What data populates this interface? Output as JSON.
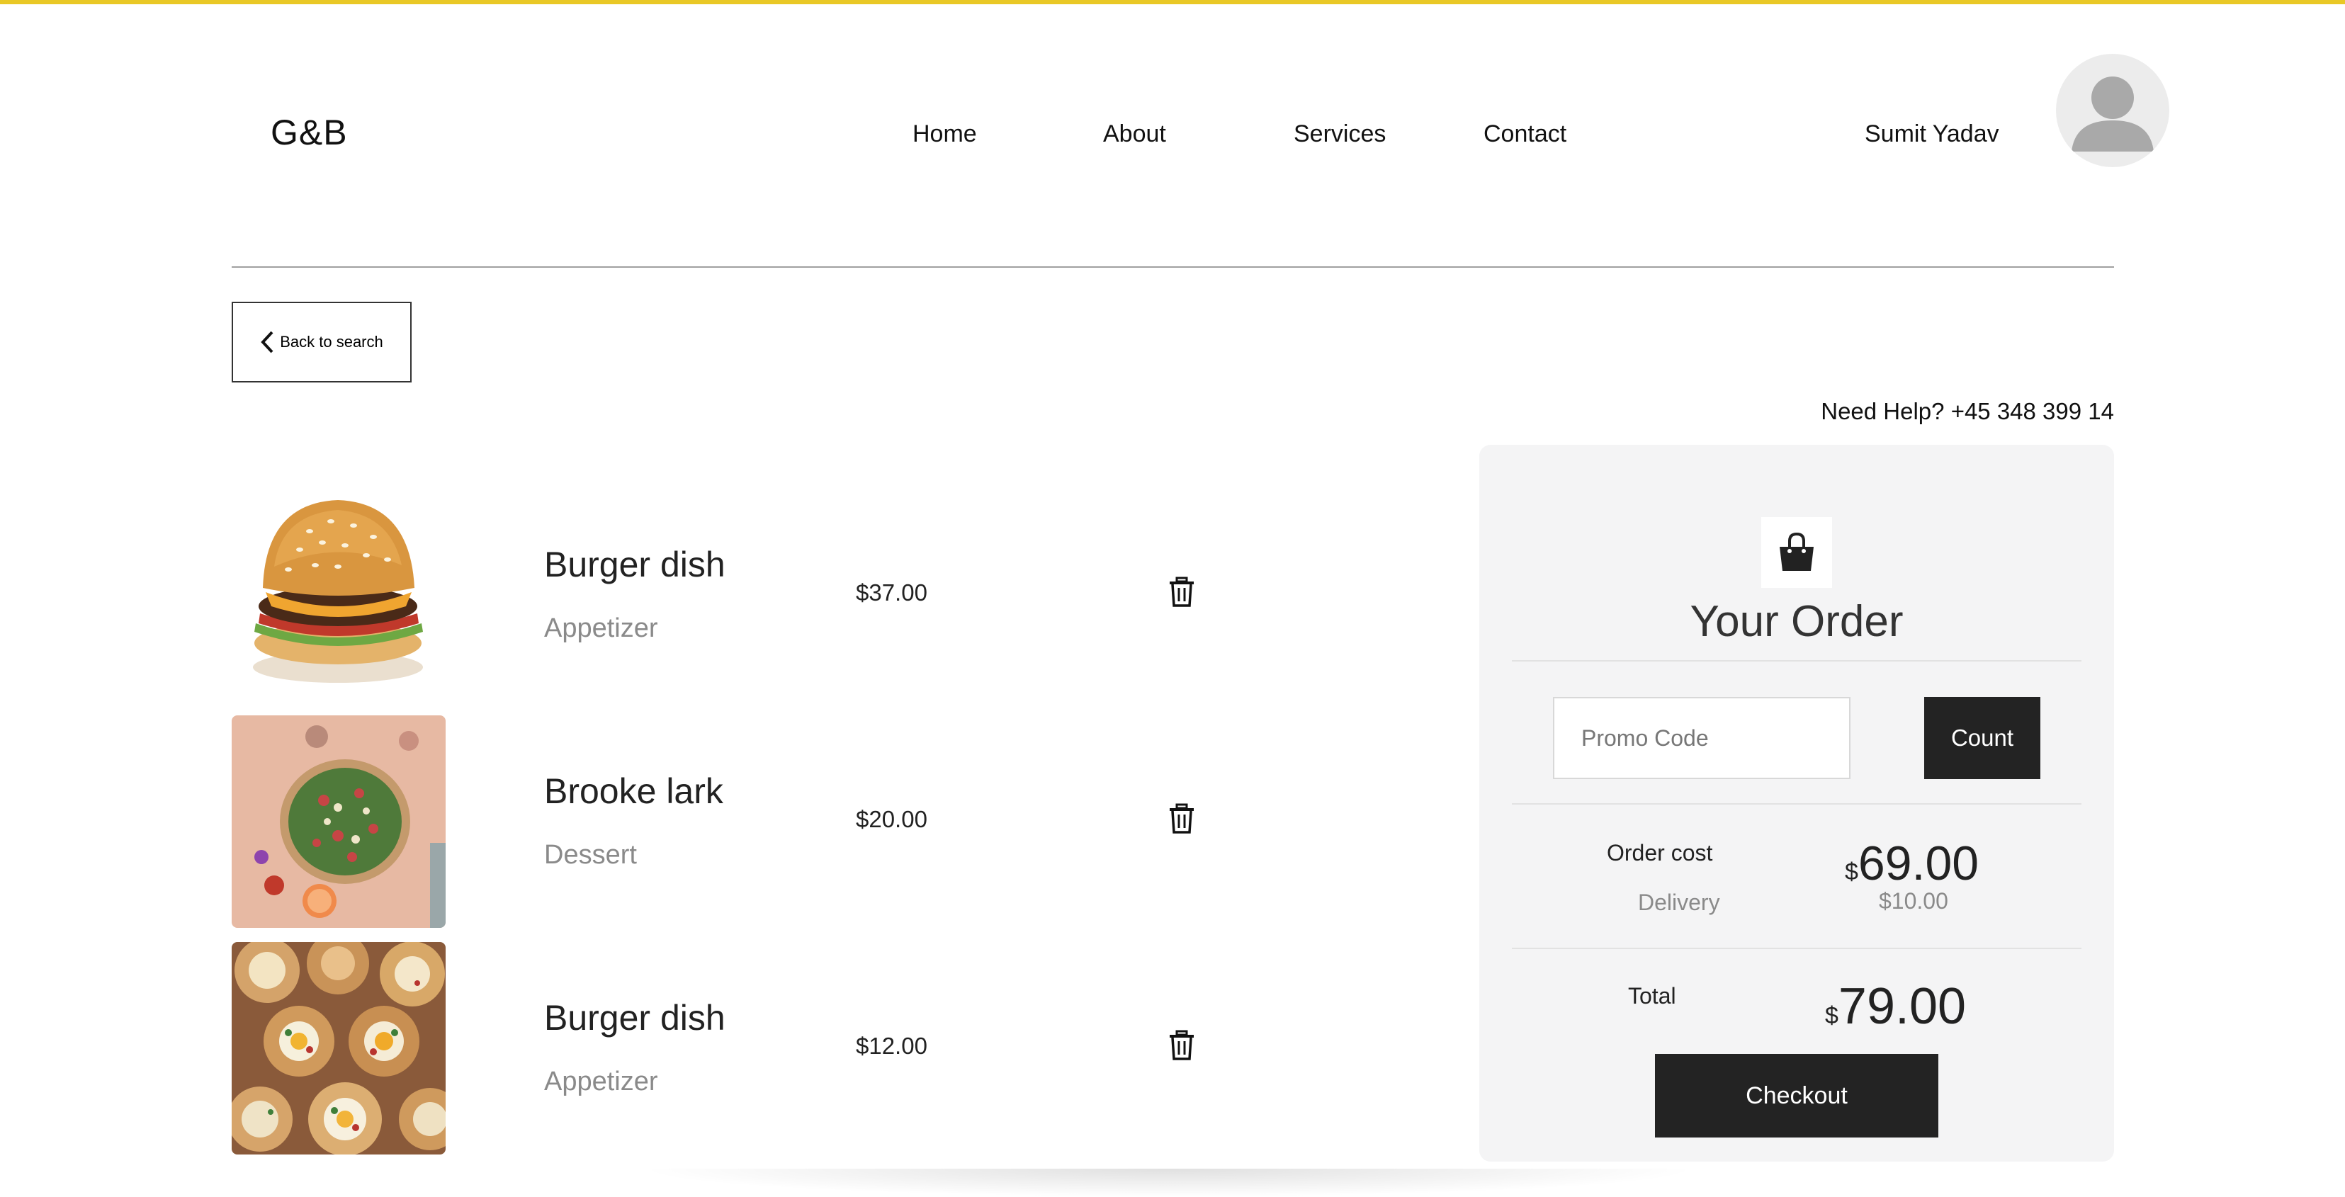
{
  "header": {
    "logo": "G&B",
    "nav": [
      "Home",
      "About",
      "Services",
      "Contact"
    ],
    "username": "Sumit Yadav"
  },
  "back_button": {
    "label": "Back to search"
  },
  "help": {
    "label": "Need Help?",
    "phone": "+45 348 399 14"
  },
  "cart": {
    "items": [
      {
        "name": "Burger dish",
        "category": "Appetizer",
        "price": "$37.00",
        "image": "burger-photo"
      },
      {
        "name": "Brooke lark",
        "category": "Dessert",
        "price": "$20.00",
        "image": "salad-photo"
      },
      {
        "name": "Burger dish",
        "category": "Appetizer",
        "price": "$12.00",
        "image": "egg-bread-bowls-photo"
      }
    ]
  },
  "order": {
    "title": "Your Order",
    "promo_placeholder": "Promo Code",
    "count_label": "Count",
    "cost_label": "Order cost",
    "cost_currency": "$",
    "cost_value": "69.00",
    "delivery_label": "Delivery",
    "delivery_value": "$10.00",
    "total_label": "Total",
    "total_currency": "$",
    "total_value": "79.00",
    "checkout_label": "Checkout"
  },
  "colors": {
    "accent_bar": "#e9c826",
    "button_dark": "#232323",
    "panel_bg": "#f4f4f5"
  }
}
